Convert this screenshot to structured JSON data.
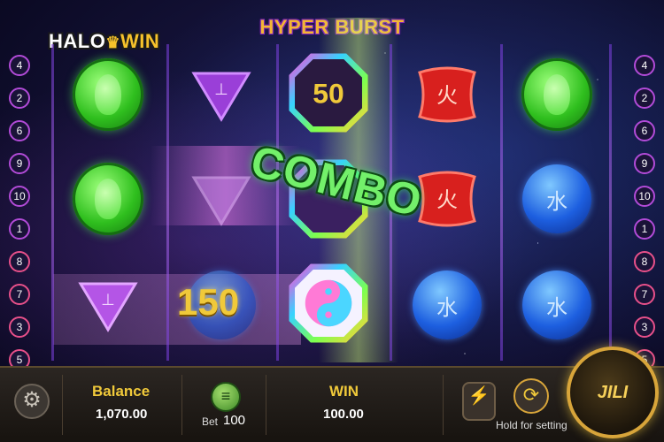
{
  "header": {
    "logo_text_left": "HALO",
    "logo_text_right": "WIN",
    "game_title": "HYPER BURST"
  },
  "paylines": {
    "left": [
      "4",
      "2",
      "6",
      "9",
      "10",
      "1",
      "8",
      "7",
      "3",
      "5"
    ],
    "right": [
      "4",
      "2",
      "6",
      "9",
      "10",
      "1",
      "8",
      "7",
      "3",
      "5"
    ]
  },
  "reels": [
    [
      "green-gourd",
      "green-gourd",
      "purple-triangle"
    ],
    [
      "purple-triangle",
      "purple-triangle",
      "multiplier-150"
    ],
    [
      "octagon-50",
      "octagon-rainbow",
      "octagon-yinyang"
    ],
    [
      "red-seal",
      "red-seal",
      "blue-water-orb"
    ],
    [
      "green-gourd",
      "blue-water-orb",
      "blue-water-orb"
    ]
  ],
  "win_effects": {
    "multiplier_label": "150",
    "octagon_value": "50",
    "combo_text": "COMBO"
  },
  "symbols_text": {
    "triangle_glyph": "⊥",
    "red_glyph": "火",
    "blue_glyph": "水"
  },
  "footer": {
    "balance_label": "Balance",
    "balance_value": "1,070.00",
    "bet_label": "Bet",
    "bet_value": "100",
    "win_label": "WIN",
    "win_value": "100.00",
    "hold_hint": "Hold for setting",
    "spin_label": "JILI"
  },
  "icons": [
    "gear-icon",
    "chip-icon",
    "lightning-icon",
    "autoplay-icon",
    "spin-icon"
  ],
  "colors": {
    "accent_gold": "#f0c93a",
    "reel_border": "#7b3fe0",
    "combo_green": "#73f06a"
  }
}
